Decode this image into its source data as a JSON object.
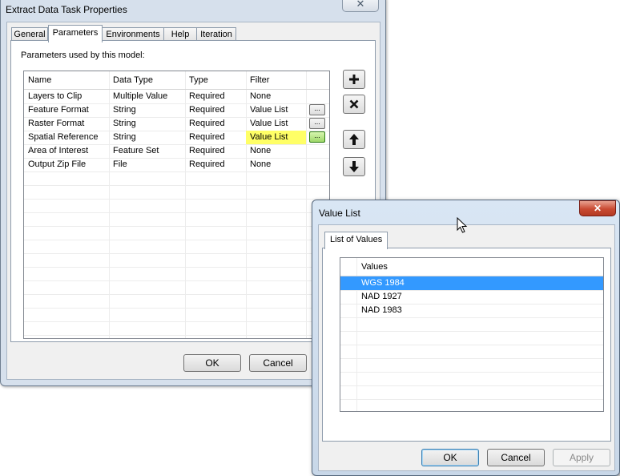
{
  "main_dialog": {
    "title": "Extract Data Task Properties",
    "tabs": [
      "General",
      "Parameters",
      "Environments",
      "Help",
      "Iteration"
    ],
    "active_tab": "Parameters",
    "params_label": "Parameters used by this model:",
    "columns": [
      "Name",
      "Data Type",
      "Type",
      "Filter"
    ],
    "rows": [
      {
        "name": "Layers to Clip",
        "data_type": "Multiple Value",
        "type": "Required",
        "filter": "None",
        "has_button": false
      },
      {
        "name": "Feature Format",
        "data_type": "String",
        "type": "Required",
        "filter": "Value List",
        "has_button": true
      },
      {
        "name": "Raster Format",
        "data_type": "String",
        "type": "Required",
        "filter": "Value List",
        "has_button": true
      },
      {
        "name": "Spatial Reference",
        "data_type": "String",
        "type": "Required",
        "filter": "Value List",
        "has_button": true,
        "highlighted": true
      },
      {
        "name": "Area of Interest",
        "data_type": "Feature Set",
        "type": "Required",
        "filter": "None",
        "has_button": false
      },
      {
        "name": "Output Zip File",
        "data_type": "File",
        "type": "Required",
        "filter": "None",
        "has_button": false
      }
    ],
    "ellipsis_label": "...",
    "ok_label": "OK",
    "cancel_label": "Cancel",
    "close_glyph": "✕",
    "side_buttons": [
      "plus-icon",
      "x-icon",
      "arrow-up-icon",
      "arrow-down-icon"
    ]
  },
  "value_list_dialog": {
    "title": "Value List",
    "tab": "List of Values",
    "column": "Values",
    "values": [
      "WGS 1984",
      "NAD 1927",
      "NAD 1983"
    ],
    "selected_value": "WGS 1984",
    "ok_label": "OK",
    "cancel_label": "Cancel",
    "apply_label": "Apply",
    "close_glyph": "✕"
  },
  "colors": {
    "highlight": "#ffff66",
    "selection": "#3399ff",
    "close_red": "#c94a32"
  }
}
